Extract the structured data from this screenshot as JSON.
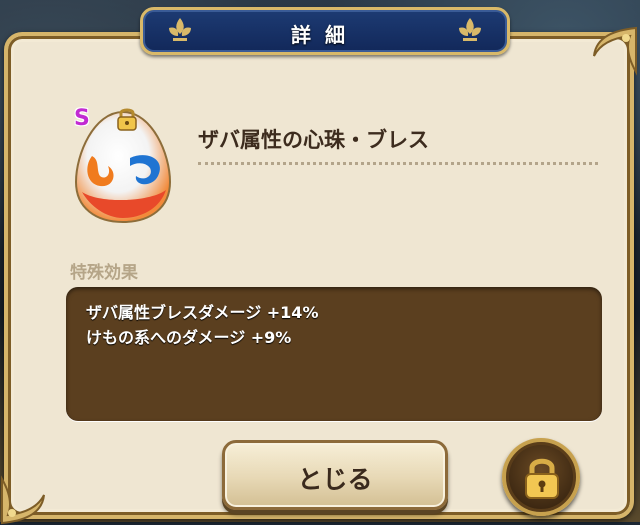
{
  "dialog": {
    "title": "詳細",
    "item": {
      "rank": "S",
      "name": "ザバ属性の心珠・ブレス",
      "orb_icon": "orb-fire-water-icon",
      "locked": true
    },
    "effects": {
      "heading": "特殊効果",
      "lines": [
        "ザバ属性ブレスダメージ +14%",
        "けもの系へのダメージ +9%"
      ]
    },
    "buttons": {
      "close_label": "とじる",
      "lock_icon": "padlock-icon"
    }
  },
  "colors": {
    "panel": "#efe6d2",
    "title_plate": "#1d3b73",
    "gold_trim": "#d6b56a",
    "effect_box": "#5b3f1f",
    "rank": "#c22ad2"
  }
}
